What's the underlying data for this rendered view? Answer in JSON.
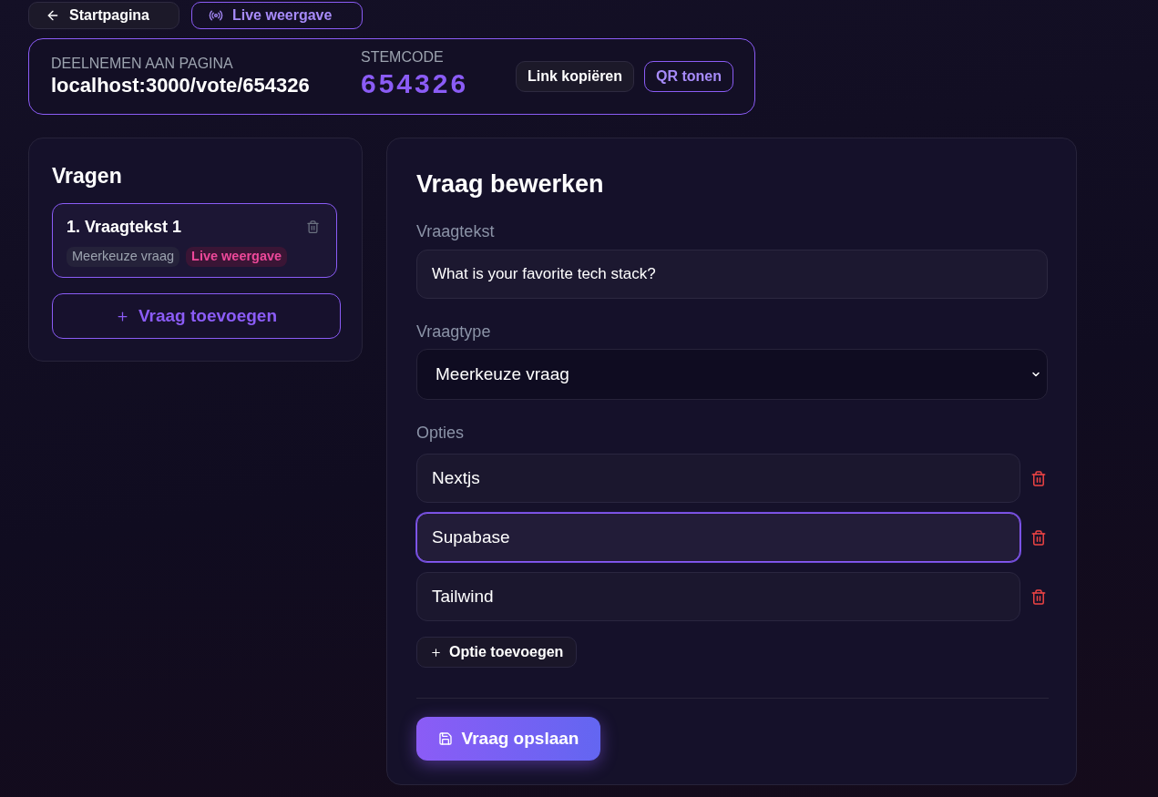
{
  "nav_buttons": [
    {
      "label": "Startpagina",
      "kind": "secondary"
    },
    {
      "label": "Live weergave",
      "kind": "outline"
    }
  ],
  "join_bar": {
    "label": "DEELNEMEN AAN PAGINA",
    "url": "localhost:3000/vote/654326",
    "code_label": "STEMCODE",
    "code": "654326",
    "buttons": [
      {
        "label": "Link kopiëren",
        "kind": "secondary"
      },
      {
        "label": "QR tonen",
        "kind": "outline"
      }
    ]
  },
  "questions_panel": {
    "title": "Vragen",
    "questions": [
      {
        "title": "1. Vraagtekst 1",
        "selected": true,
        "badges": [
          {
            "label": "Meerkeuze vraag",
            "kind": "type"
          },
          {
            "label": "Live weergave",
            "kind": "live"
          }
        ]
      }
    ],
    "add_button": "Vraag toevoegen"
  },
  "editor": {
    "title": "Vraag bewerken",
    "question_label": "Vraagtekst",
    "question_value": "What is your favorite tech stack?",
    "type_label": "Vraagtype",
    "type_value": "Meerkeuze vraag",
    "options_label": "Opties",
    "options": [
      {
        "value": "Nextjs",
        "focused": false
      },
      {
        "value": "Supabase",
        "focused": true
      },
      {
        "value": "Tailwind",
        "focused": false
      }
    ],
    "add_option": "Optie toevoegen",
    "save_button": "Vraag opslaan"
  }
}
